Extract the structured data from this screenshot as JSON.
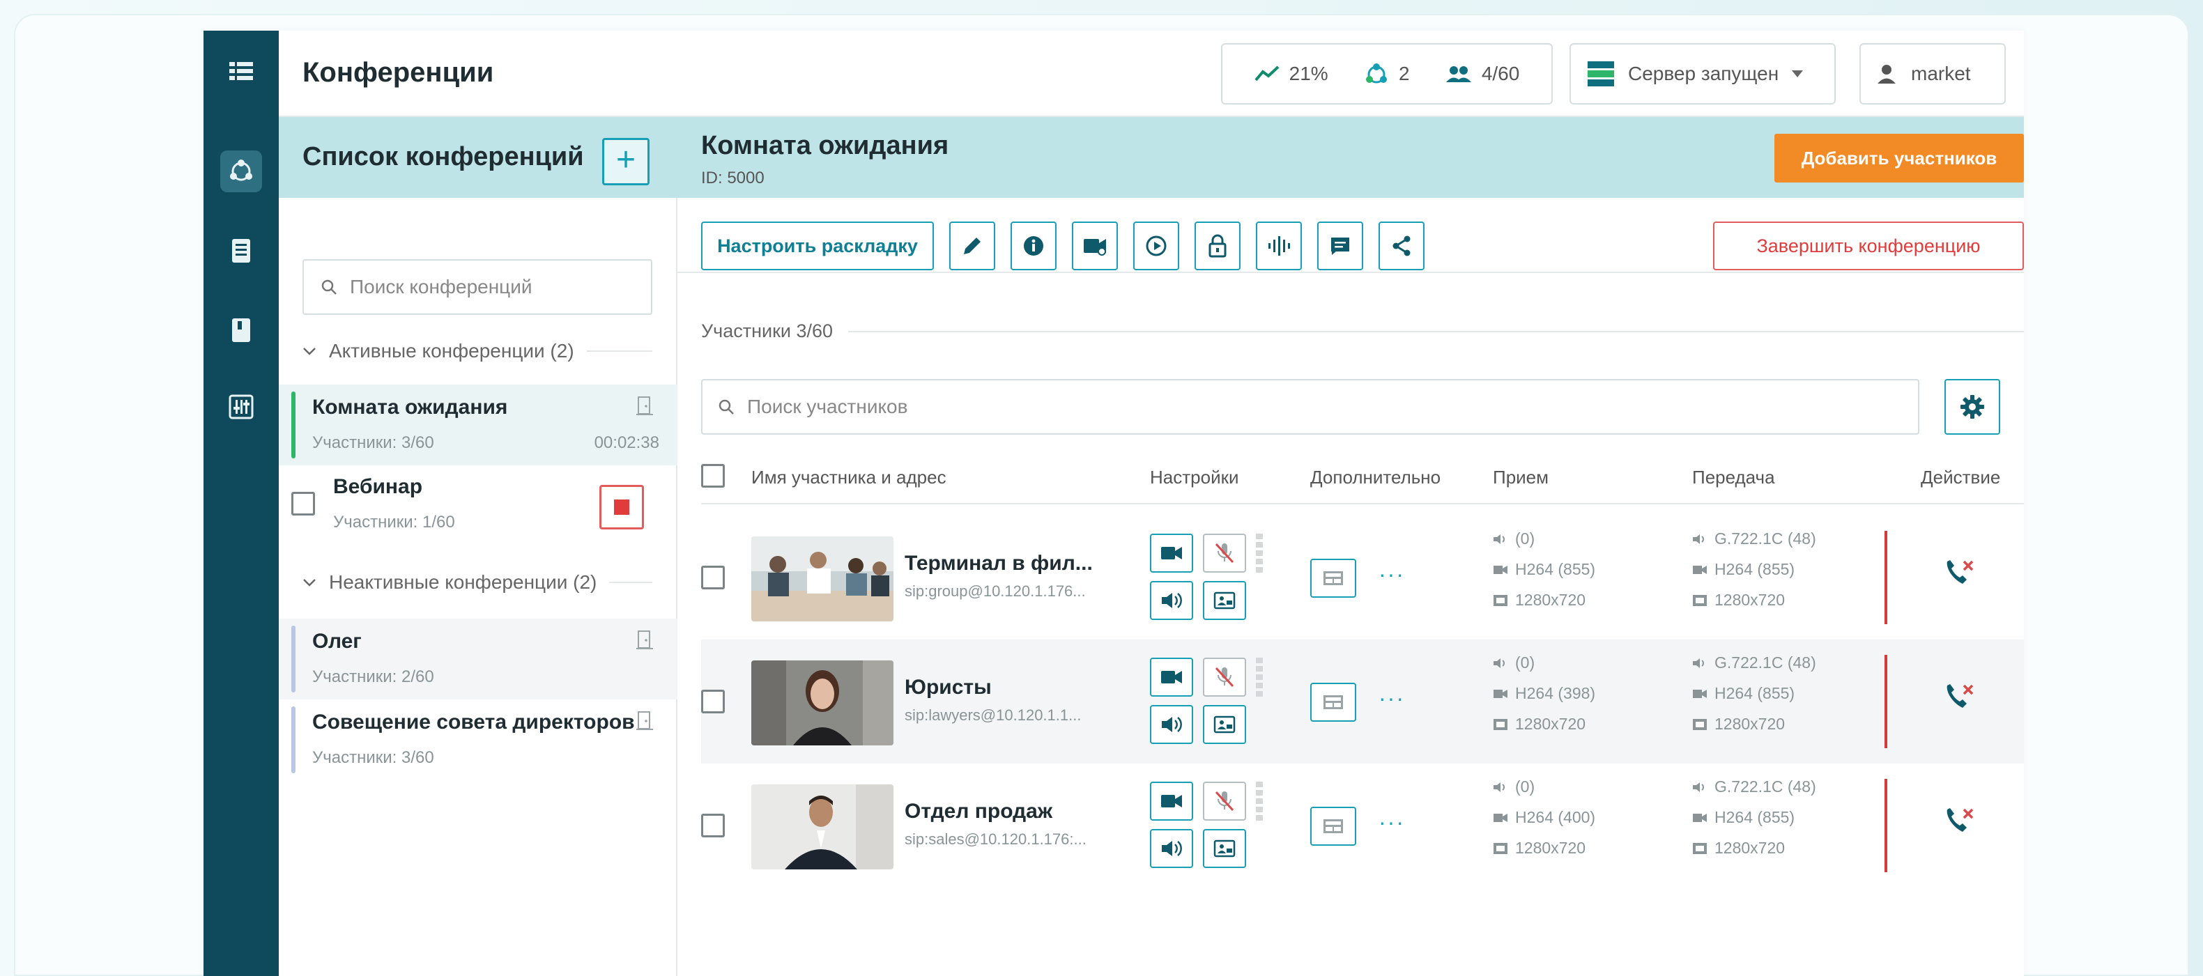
{
  "header": {
    "title": "Конференции",
    "stats": {
      "cpu": "21%",
      "conferences": "2",
      "participants": "4/60"
    },
    "server_status": "Сервер запущен",
    "user": "market"
  },
  "conference_list": {
    "title": "Список конференций",
    "search_placeholder": "Поиск конференций",
    "active_group": "Активные конференции (2)",
    "inactive_group": "Неактивные конференции (2)",
    "active": [
      {
        "name": "Комната ожидания",
        "participants": "Участники: 3/60",
        "time": "00:02:38",
        "selected": true
      },
      {
        "name": "Вебинар",
        "participants": "Участники: 1/60"
      }
    ],
    "inactive": [
      {
        "name": "Олег",
        "participants": "Участники: 2/60"
      },
      {
        "name": "Совещение совета директоров",
        "participants": "Участники: 3/60"
      }
    ]
  },
  "room": {
    "title": "Комната ожидания",
    "id": "ID: 5000",
    "add_button": "Добавить участников",
    "layout_button": "Настроить раскладку",
    "end_button": "Завершить конференцию",
    "participants_title": "Участники 3/60",
    "search_placeholder": "Поиск участников"
  },
  "table": {
    "columns": [
      "Имя участника и адрес",
      "Настройки",
      "Дополнительно",
      "Прием",
      "Передача",
      "Действие"
    ],
    "rows": [
      {
        "name": "Терминал в фил...",
        "address": "sip:group@10.120.1.176...",
        "rx": {
          "audio": "(0)",
          "video": "H264 (855)",
          "res": "1280x720"
        },
        "tx": {
          "audio": "G.722.1C (48)",
          "video": "H264 (855)",
          "res": "1280x720"
        }
      },
      {
        "name": "Юристы",
        "address": "sip:lawyers@10.120.1.1...",
        "rx": {
          "audio": "(0)",
          "video": "H264 (398)",
          "res": "1280x720"
        },
        "tx": {
          "audio": "G.722.1C (48)",
          "video": "H264 (855)",
          "res": "1280x720"
        }
      },
      {
        "name": "Отдел продаж",
        "address": "sip:sales@10.120.1.176:...",
        "rx": {
          "audio": "(0)",
          "video": "H264 (400)",
          "res": "1280x720"
        },
        "tx": {
          "audio": "G.722.1C (48)",
          "video": "H264 (855)",
          "res": "1280x720"
        }
      }
    ]
  },
  "colors": {
    "accent": "#17a0b5",
    "rail": "#0f4a5c",
    "header_band": "#bfe4e7",
    "orange": "#f28a26",
    "danger": "#e03c3c"
  }
}
